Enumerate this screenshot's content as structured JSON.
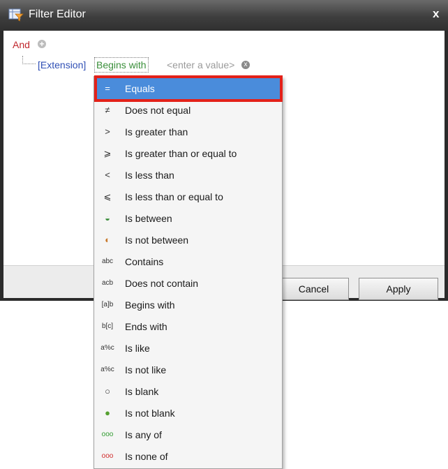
{
  "window": {
    "title": "Filter Editor",
    "close_glyph": "x"
  },
  "filter": {
    "group_operator": "And",
    "add_glyph": "+",
    "field": "[Extension]",
    "operator": "Begins with",
    "value_placeholder": "<enter a value>",
    "remove_glyph": "x"
  },
  "buttons": {
    "cancel": "Cancel",
    "apply": "Apply"
  },
  "operators_menu": {
    "selected_index": 0,
    "items": [
      {
        "label": "Equals",
        "icon": "equals-icon",
        "glyph": "="
      },
      {
        "label": "Does not equal",
        "icon": "not-equal-icon",
        "glyph": "≠"
      },
      {
        "label": "Is greater than",
        "icon": "greater-than-icon",
        "glyph": ">"
      },
      {
        "label": "Is greater than or equal to",
        "icon": "greater-equal-icon",
        "glyph": "⩾"
      },
      {
        "label": "Is less than",
        "icon": "less-than-icon",
        "glyph": "<"
      },
      {
        "label": "Is less than or equal to",
        "icon": "less-equal-icon",
        "glyph": "⩽"
      },
      {
        "label": "Is between",
        "icon": "between-icon",
        "glyph": "◒"
      },
      {
        "label": "Is not between",
        "icon": "not-between-icon",
        "glyph": "◐"
      },
      {
        "label": "Contains",
        "icon": "contains-icon",
        "glyph": "abc"
      },
      {
        "label": "Does not contain",
        "icon": "not-contains-icon",
        "glyph": "acb"
      },
      {
        "label": "Begins with",
        "icon": "begins-with-icon",
        "glyph": "[a]b"
      },
      {
        "label": "Ends with",
        "icon": "ends-with-icon",
        "glyph": "b[c]"
      },
      {
        "label": "Is like",
        "icon": "like-icon",
        "glyph": "a%c"
      },
      {
        "label": "Is not like",
        "icon": "not-like-icon",
        "glyph": "a%c"
      },
      {
        "label": "Is blank",
        "icon": "blank-icon",
        "glyph": "○"
      },
      {
        "label": "Is not blank",
        "icon": "not-blank-icon",
        "glyph": "●"
      },
      {
        "label": "Is any of",
        "icon": "any-of-icon",
        "glyph": "ooo"
      },
      {
        "label": "Is none of",
        "icon": "none-of-icon",
        "glyph": "ooo"
      }
    ]
  },
  "colors": {
    "selected_bg": "#4a8cdb",
    "highlight_border": "#e32119",
    "group_red": "#c0272d",
    "field_blue": "#2f4fb5",
    "operator_green": "#3a8f3a"
  }
}
